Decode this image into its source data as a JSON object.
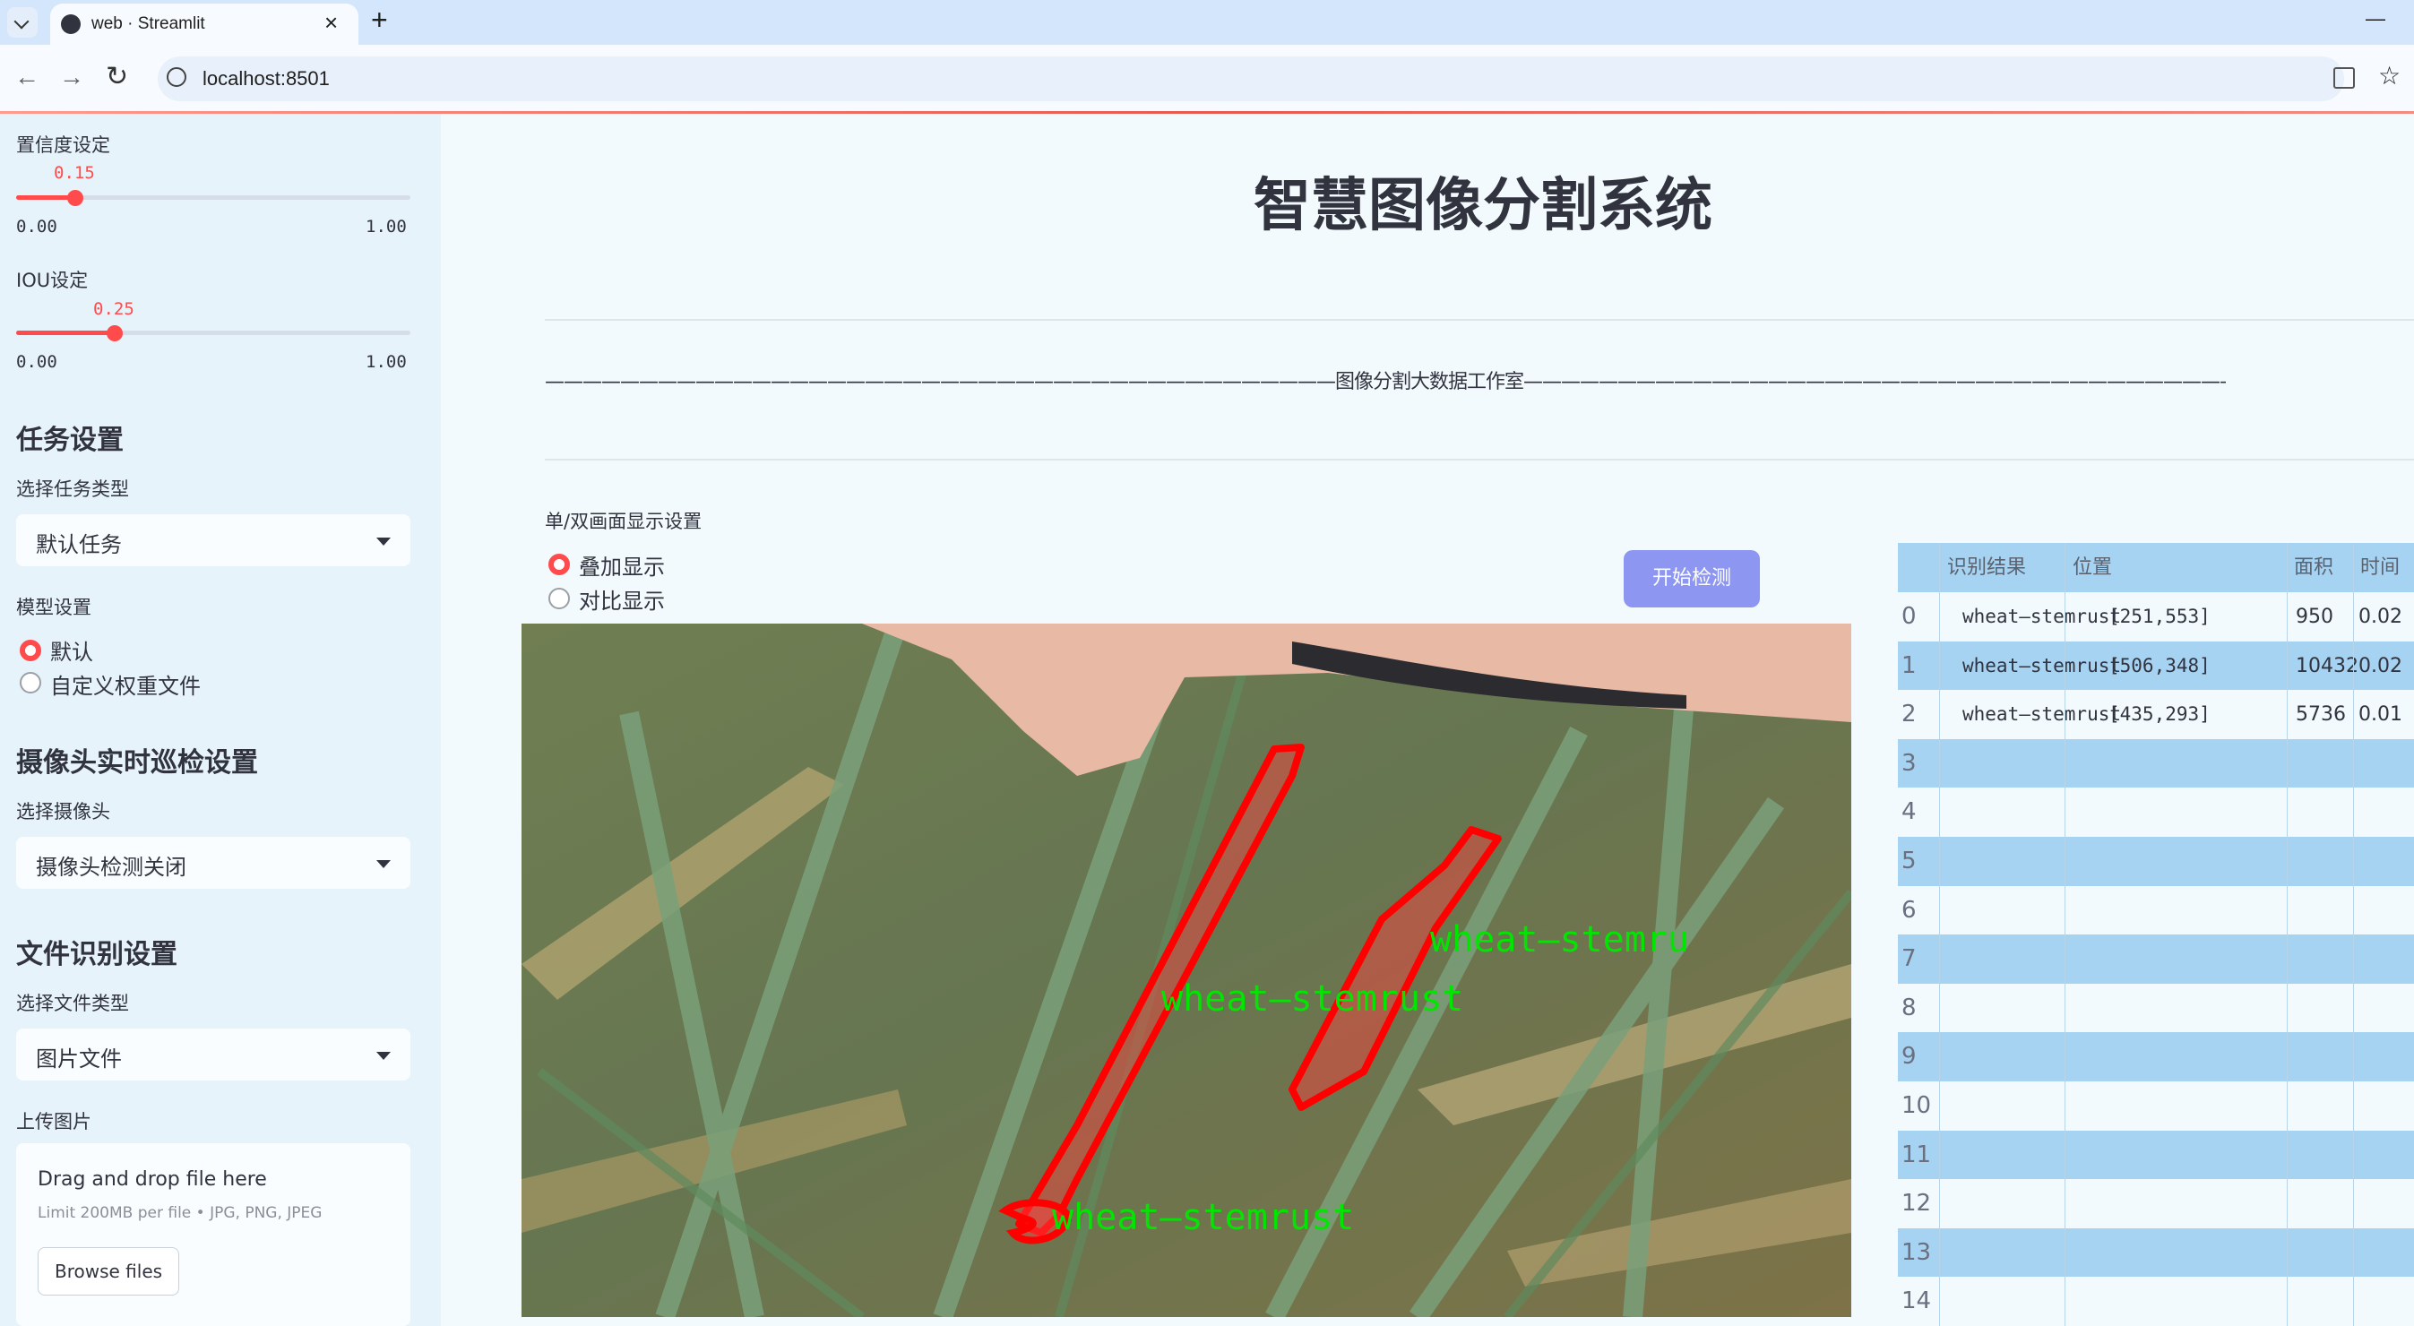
{
  "browser": {
    "tab_title": "web · Streamlit",
    "tab_close": "×",
    "new_tab": "+",
    "url": "localhost:8501",
    "minimize": "—"
  },
  "sidebar": {
    "confidence": {
      "label": "置信度设定",
      "value": "0.15",
      "value_fraction": 0.15,
      "min": "0.00",
      "max": "1.00"
    },
    "iou": {
      "label": "IOU设定",
      "value": "0.25",
      "value_fraction": 0.25,
      "min": "0.00",
      "max": "1.00"
    },
    "task_header": "任务设置",
    "task_type_label": "选择任务类型",
    "task_type_value": "默认任务",
    "model_label": "模型设置",
    "model_options": [
      "默认",
      "自定义权重文件"
    ],
    "camera_header": "摄像头实时巡检设置",
    "camera_label": "选择摄像头",
    "camera_value": "摄像头检测关闭",
    "file_header": "文件识别设置",
    "file_type_label": "选择文件类型",
    "file_type_value": "图片文件",
    "upload_label": "上传图片",
    "upload": {
      "drop_text": "Drag and drop file here",
      "limit_text": "Limit 200MB per file • JPG, PNG, JPEG",
      "browse_label": "Browse files"
    }
  },
  "main": {
    "title": "智慧图像分割系统",
    "divider_text": "——————————————————————————————————————————图像分割大数据工作室——————————————————————————————————————————",
    "display_label": "单/双画面显示设置",
    "display_options": [
      "叠加显示",
      "对比显示"
    ],
    "start_button": "开始检测",
    "detections": [
      {
        "label": "wheat—stemrust"
      },
      {
        "label": "wheat—stemrust"
      },
      {
        "label": "wheat—stemru"
      }
    ]
  },
  "table": {
    "headers": [
      "识别结果",
      "位置",
      "面积",
      "时间"
    ],
    "rows": [
      {
        "idx": "0",
        "result": "wheat—stemrust",
        "pos": "[251,553]",
        "area": "950",
        "time": "0.02"
      },
      {
        "idx": "1",
        "result": "wheat—stemrust",
        "pos": "[506,348]",
        "area": "10432",
        "time": "0.02"
      },
      {
        "idx": "2",
        "result": "wheat—stemrust",
        "pos": "[435,293]",
        "area": "5736",
        "time": "0.01"
      },
      {
        "idx": "3"
      },
      {
        "idx": "4"
      },
      {
        "idx": "5"
      },
      {
        "idx": "6"
      },
      {
        "idx": "7"
      },
      {
        "idx": "8"
      },
      {
        "idx": "9"
      },
      {
        "idx": "10"
      },
      {
        "idx": "11"
      },
      {
        "idx": "12"
      },
      {
        "idx": "13"
      },
      {
        "idx": "14"
      }
    ]
  },
  "colors": {
    "accent": "#ff4b4b",
    "button": "#8d96f1",
    "mask": "#ff0000",
    "label": "#00ff00"
  }
}
